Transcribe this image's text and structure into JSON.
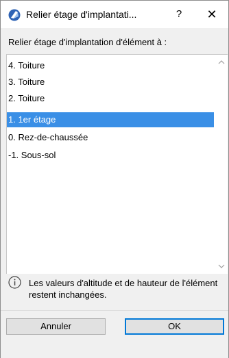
{
  "window": {
    "title": "Relier étage d'implantati...",
    "help_label": "?",
    "close_label": "✕"
  },
  "prompt": "Relier étage d'implantation d'élément à :",
  "list": {
    "items": [
      "4. Toiture",
      "3. Toiture",
      "2. Toiture",
      "1. 1er étage",
      "0. Rez-de-chaussée",
      "-1. Sous-sol"
    ],
    "selected_index": 3
  },
  "info": {
    "text": "Les valeurs d'altitude et de hauteur de l'élément restent inchangées."
  },
  "buttons": {
    "cancel_label": "Annuler",
    "ok_label": "OK"
  },
  "colors": {
    "selection": "#3a8fe6",
    "default_button_border": "#0078d7"
  }
}
